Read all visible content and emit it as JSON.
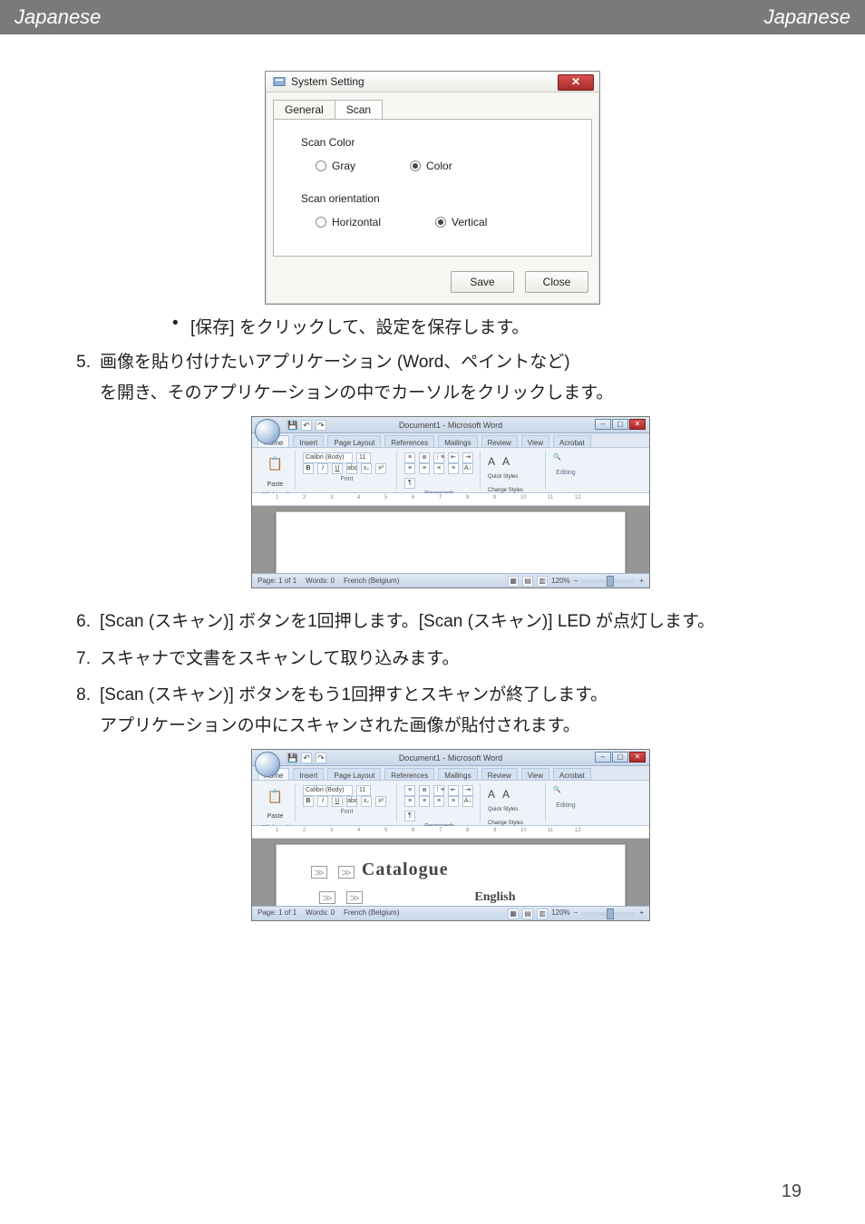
{
  "header": {
    "left": "Japanese",
    "right": "Japanese"
  },
  "dialog": {
    "title": "System Setting",
    "tabs": {
      "general": "General",
      "scan": "Scan",
      "active": "scan"
    },
    "group_scan_color": "Scan Color",
    "opt_gray": "Gray",
    "opt_color": "Color",
    "group_scan_orient": "Scan orientation",
    "opt_horizontal": "Horizontal",
    "opt_vertical": "Vertical",
    "btn_save": "Save",
    "btn_close": "Close"
  },
  "bullet_save_click": "[保存] をクリックして、設定を保存します。",
  "steps": {
    "n5": "5.",
    "s5a": "画像を貼り付けたいアプリケーション (Word、ペイントなど)",
    "s5b": "を開き、そのアプリケーションの中でカーソルをクリックします。",
    "n6": "6.",
    "s6": "[Scan (スキャン)] ボタンを1回押します。[Scan (スキャン)] LED が点灯します。",
    "n7": "7.",
    "s7": "スキャナで文書をスキャンして取り込みます。",
    "n8": "8.",
    "s8a": "[Scan (スキャン)] ボタンをもう1回押すとスキャンが終了します。",
    "s8b": "アプリケーションの中にスキャンされた画像が貼付されます。"
  },
  "word": {
    "title": "Document1 - Microsoft Word",
    "tabs": [
      "Home",
      "Insert",
      "Page Layout",
      "References",
      "Mailings",
      "Review",
      "View",
      "Acrobat"
    ],
    "active_tab": "Home",
    "groups": {
      "clipboard": "Clipboard",
      "paste": "Paste",
      "font": "Font",
      "font_name": "Calibri (Body)",
      "font_size": "11",
      "paragraph": "Paragraph",
      "styles": "Styles",
      "quick_styles": "Quick Styles",
      "change_styles": "Change Styles",
      "editing": "Editing",
      "find_icon": "🔍"
    },
    "ruler_marks": [
      "1",
      "2",
      "3",
      "4",
      "5",
      "6",
      "7",
      "8",
      "9",
      "10",
      "11",
      "12"
    ],
    "status_left1": "Page: 1 of 1",
    "status_left2": "Words: 0",
    "status_left3": "French (Belgium)",
    "zoom": "120%"
  },
  "word2_catalogue": {
    "line1": "Catalogue",
    "line2": "English"
  },
  "page_number": "19"
}
